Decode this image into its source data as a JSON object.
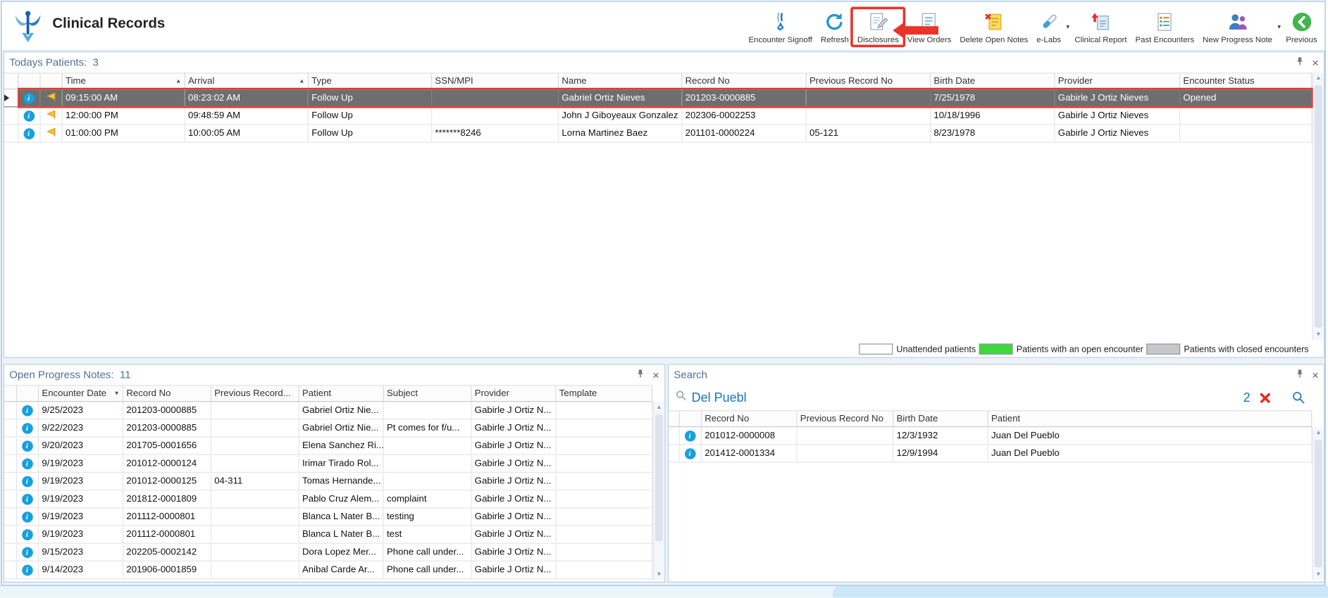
{
  "app": {
    "title": "Clinical Records"
  },
  "annotation_color": "#e8352a",
  "toolbar": {
    "items": [
      {
        "label": "Encounter Signoff",
        "icon": "pen-signoff-icon"
      },
      {
        "label": "Refresh",
        "icon": "refresh-icon"
      },
      {
        "label": "Disclosures",
        "icon": "disclosures-icon",
        "highlighted": true
      },
      {
        "label": "View Orders",
        "icon": "view-orders-icon",
        "arrow_annotation": true
      },
      {
        "label": "Delete Open Notes",
        "icon": "delete-open-notes-icon"
      },
      {
        "label": "e-Labs",
        "icon": "elabs-icon",
        "caret": true
      },
      {
        "label": "Clinical Report",
        "icon": "clinical-report-icon"
      },
      {
        "label": "Past Encounters",
        "icon": "past-encounters-icon"
      },
      {
        "label": "New Progress Note",
        "icon": "new-progress-note-icon",
        "caret": true
      },
      {
        "label": "Previous",
        "icon": "previous-icon"
      }
    ]
  },
  "todays_patients": {
    "title": "Todays Patients:",
    "count": "3",
    "columns": [
      {
        "label": "Time",
        "sort": "asc"
      },
      {
        "label": "Arrival",
        "sort": "asc"
      },
      {
        "label": "Type"
      },
      {
        "label": "SSN/MPI"
      },
      {
        "label": "Name"
      },
      {
        "label": "Record No"
      },
      {
        "label": "Previous Record No"
      },
      {
        "label": "Birth Date"
      },
      {
        "label": "Provider"
      },
      {
        "label": "Encounter Status"
      }
    ],
    "rows": [
      {
        "selected": true,
        "cells": [
          "09:15:00 AM",
          "08:23:02 AM",
          "Follow Up",
          "",
          "Gabriel Ortiz Nieves",
          "201203-0000885",
          "",
          "7/25/1978",
          "Gabirle J Ortiz Nieves",
          "Opened"
        ]
      },
      {
        "cells": [
          "12:00:00 PM",
          "09:48:59 AM",
          "Follow Up",
          "",
          "John J Giboyeaux Gonzalez",
          "202306-0002253",
          "",
          "10/18/1996",
          "Gabirle J Ortiz Nieves",
          ""
        ]
      },
      {
        "cells": [
          "01:00:00 PM",
          "10:00:05 AM",
          "Follow Up",
          "*******8246",
          "Lorna Martinez Baez",
          "201101-0000224",
          "05-121",
          "8/23/1978",
          "Gabirle J Ortiz Nieves",
          ""
        ]
      }
    ],
    "legend": [
      {
        "label": "Unattended patients",
        "color": "#ffffff"
      },
      {
        "label": "Patients with an open encounter",
        "color": "#3ed83e"
      },
      {
        "label": "Patients with closed encounters",
        "color": "#c8c8c8"
      }
    ]
  },
  "open_progress_notes": {
    "title": "Open Progress Notes:",
    "count": "11",
    "columns": [
      {
        "label": "Encounter Date",
        "sort": "desc"
      },
      {
        "label": "Record No"
      },
      {
        "label": "Previous Record..."
      },
      {
        "label": "Patient"
      },
      {
        "label": "Subject"
      },
      {
        "label": "Provider"
      },
      {
        "label": "Template"
      }
    ],
    "rows": [
      {
        "cells": [
          "9/25/2023",
          "201203-0000885",
          "",
          "Gabriel Ortiz Nie...",
          "",
          "Gabirle J Ortiz N...",
          ""
        ]
      },
      {
        "cells": [
          "9/22/2023",
          "201203-0000885",
          "",
          "Gabriel Ortiz Nie...",
          "Pt comes for f/u...",
          "Gabirle J Ortiz N...",
          ""
        ]
      },
      {
        "cells": [
          "9/20/2023",
          "201705-0001656",
          "",
          "Elena Sanchez Ri...",
          "",
          "Gabirle J Ortiz N...",
          ""
        ]
      },
      {
        "cells": [
          "9/19/2023",
          "201012-0000124",
          "",
          "Irimar Tirado Rol...",
          "",
          "Gabirle J Ortiz N...",
          ""
        ]
      },
      {
        "cells": [
          "9/19/2023",
          "201012-0000125",
          "04-311",
          "Tomas Hernande...",
          "",
          "Gabirle J Ortiz N...",
          ""
        ]
      },
      {
        "cells": [
          "9/19/2023",
          "201812-0001809",
          "",
          "Pablo Cruz Alem...",
          "complaint",
          "Gabirle J Ortiz N...",
          ""
        ]
      },
      {
        "cells": [
          "9/19/2023",
          "201112-0000801",
          "",
          "Blanca L Nater B...",
          "testing",
          "Gabirle J Ortiz N...",
          ""
        ]
      },
      {
        "cells": [
          "9/19/2023",
          "201112-0000801",
          "",
          "Blanca L Nater B...",
          "test",
          "Gabirle J Ortiz N...",
          ""
        ]
      },
      {
        "cells": [
          "9/15/2023",
          "202205-0002142",
          "",
          "Dora Lopez Mer...",
          "Phone call under...",
          "Gabirle J Ortiz N...",
          ""
        ]
      },
      {
        "cells": [
          "9/14/2023",
          "201906-0001859",
          "",
          "Anibal Carde Ar...",
          "Phone call under...",
          "Gabirle J Ortiz N...",
          ""
        ]
      }
    ]
  },
  "search": {
    "title": "Search",
    "query": "Del Puebl",
    "result_count": "2",
    "columns": [
      {
        "label": "Record No"
      },
      {
        "label": "Previous Record No"
      },
      {
        "label": "Birth Date"
      },
      {
        "label": "Patient"
      }
    ],
    "rows": [
      {
        "cells": [
          "201012-0000008",
          "",
          "12/3/1932",
          "Juan Del Pueblo"
        ]
      },
      {
        "cells": [
          "201412-0001334",
          "",
          "12/9/1994",
          "Juan Del Pueblo"
        ]
      }
    ]
  }
}
